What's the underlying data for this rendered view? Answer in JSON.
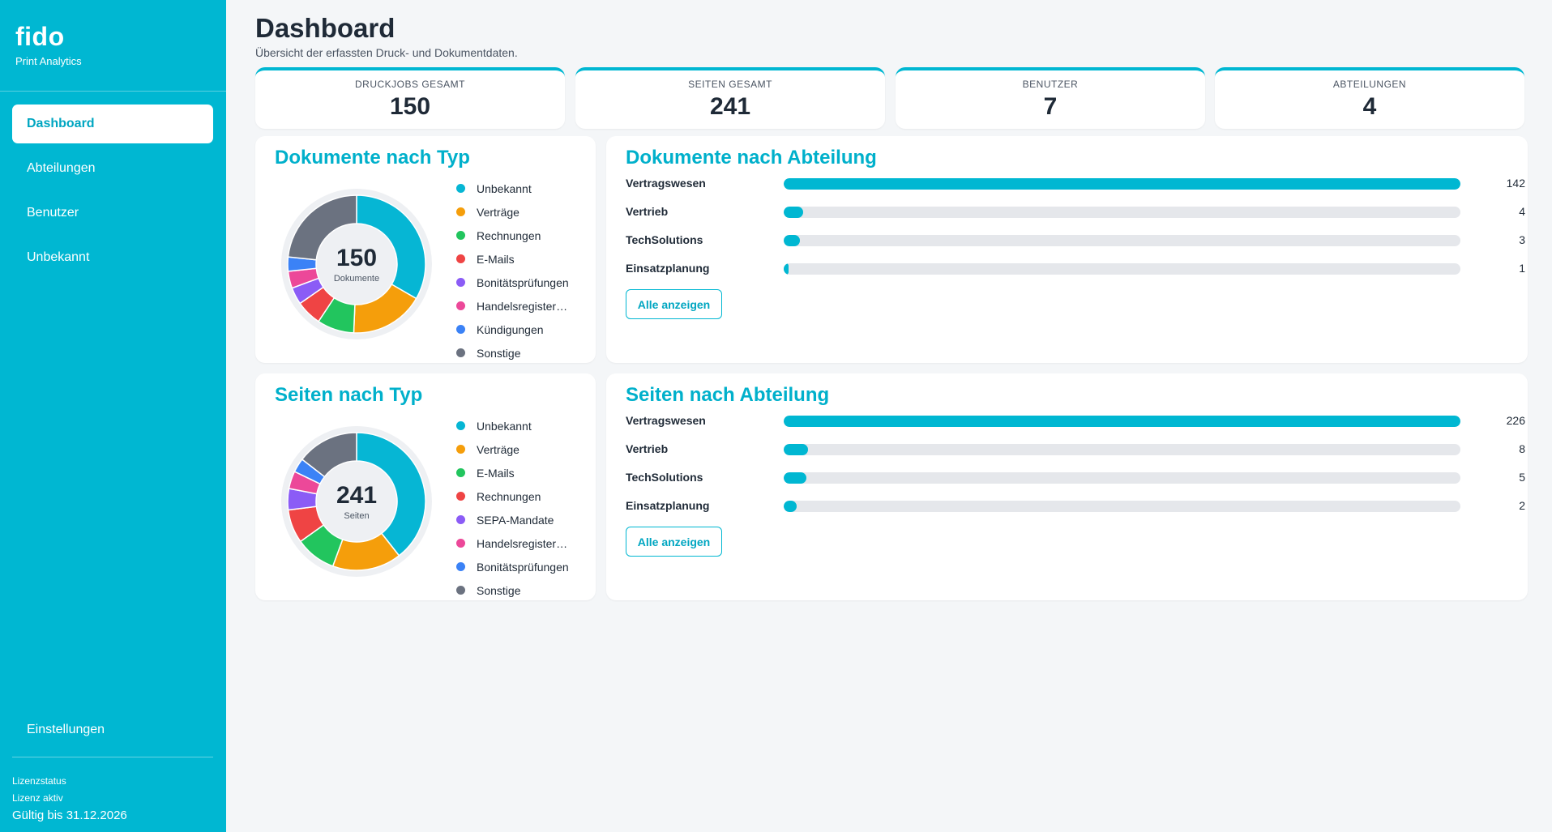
{
  "brand": {
    "name": "fido",
    "subtitle": "Print Analytics"
  },
  "sidebar": {
    "items": [
      {
        "label": "Dashboard",
        "active": true
      },
      {
        "label": "Abteilungen"
      },
      {
        "label": "Benutzer"
      },
      {
        "label": "Unbekannt"
      }
    ],
    "settings_label": "Einstellungen",
    "license": {
      "title": "Lizenzstatus",
      "status": "Lizenz aktiv",
      "valid_until": "Gültig bis 31.12.2026"
    }
  },
  "header": {
    "title": "Dashboard",
    "subtitle": "Übersicht der erfassten Druck- und Dokumentdaten."
  },
  "kpis": [
    {
      "label": "DRUCKJOBS GESAMT",
      "value": "150"
    },
    {
      "label": "SEITEN GESAMT",
      "value": "241"
    },
    {
      "label": "BENUTZER",
      "value": "7"
    },
    {
      "label": "ABTEILUNGEN",
      "value": "4"
    }
  ],
  "colors": {
    "accent": "#00b7d2",
    "cyan": "#06b6d4",
    "orange": "#f59e0b",
    "green": "#22c55e",
    "red": "#ef4444",
    "purple": "#8b5cf6",
    "pink": "#ec4899",
    "blue": "#3b82f6",
    "gray": "#6b7280"
  },
  "doc_type": {
    "title": "Dokumente nach Typ",
    "center_value": "150",
    "center_caption": "Dokumente",
    "legend": [
      {
        "label": "Unbekannt",
        "color": "#06b6d4"
      },
      {
        "label": "Verträge",
        "color": "#f59e0b"
      },
      {
        "label": "Rechnungen",
        "color": "#22c55e"
      },
      {
        "label": "E-Mails",
        "color": "#ef4444"
      },
      {
        "label": "Bonitätsprüfungen",
        "color": "#8b5cf6"
      },
      {
        "label": "Handelsregistera...",
        "color": "#ec4899"
      },
      {
        "label": "Kündigungen",
        "color": "#3b82f6"
      },
      {
        "label": "Sonstige",
        "color": "#6b7280"
      }
    ]
  },
  "page_type": {
    "title": "Seiten nach Typ",
    "center_value": "241",
    "center_caption": "Seiten",
    "legend": [
      {
        "label": "Unbekannt",
        "color": "#06b6d4"
      },
      {
        "label": "Verträge",
        "color": "#f59e0b"
      },
      {
        "label": "E-Mails",
        "color": "#22c55e"
      },
      {
        "label": "Rechnungen",
        "color": "#ef4444"
      },
      {
        "label": "SEPA-Mandate",
        "color": "#8b5cf6"
      },
      {
        "label": "Handelsregistera...",
        "color": "#ec4899"
      },
      {
        "label": "Bonitätsprüfungen",
        "color": "#3b82f6"
      },
      {
        "label": "Sonstige",
        "color": "#6b7280"
      }
    ]
  },
  "doc_dept": {
    "title": "Dokumente nach Abteilung",
    "button_label": "Alle anzeigen",
    "rows": [
      {
        "label": "Vertragswesen",
        "value": "142"
      },
      {
        "label": "Vertrieb",
        "value": "4"
      },
      {
        "label": "TechSolutions",
        "value": "3"
      },
      {
        "label": "Einsatzplanung",
        "value": "1"
      }
    ]
  },
  "page_dept": {
    "title": "Seiten nach Abteilung",
    "button_label": "Alle anzeigen",
    "rows": [
      {
        "label": "Vertragswesen",
        "value": "226"
      },
      {
        "label": "Vertrieb",
        "value": "8"
      },
      {
        "label": "TechSolutions",
        "value": "5"
      },
      {
        "label": "Einsatzplanung",
        "value": "2"
      }
    ]
  },
  "chart_data": [
    {
      "type": "pie",
      "title": "Dokumente nach Typ",
      "categories": [
        "Unbekannt",
        "Verträge",
        "Rechnungen",
        "E-Mails",
        "Bonitätsprüfungen",
        "Handelsregistera...",
        "Kündigungen",
        "Sonstige"
      ],
      "values": [
        50,
        26,
        13,
        9,
        6,
        6,
        5,
        35
      ],
      "total": 150
    },
    {
      "type": "pie",
      "title": "Seiten nach Typ",
      "categories": [
        "Unbekannt",
        "Verträge",
        "E-Mails",
        "Rechnungen",
        "SEPA-Mandate",
        "Handelsregistera...",
        "Bonitätsprüfungen",
        "Sonstige"
      ],
      "values": [
        95,
        39,
        23,
        19,
        12,
        10,
        8,
        35
      ],
      "total": 241
    },
    {
      "type": "bar",
      "title": "Dokumente nach Abteilung",
      "categories": [
        "Vertragswesen",
        "Vertrieb",
        "TechSolutions",
        "Einsatzplanung"
      ],
      "values": [
        142,
        4,
        3,
        1
      ]
    },
    {
      "type": "bar",
      "title": "Seiten nach Abteilung",
      "categories": [
        "Vertragswesen",
        "Vertrieb",
        "TechSolutions",
        "Einsatzplanung"
      ],
      "values": [
        226,
        8,
        5,
        2
      ]
    }
  ]
}
